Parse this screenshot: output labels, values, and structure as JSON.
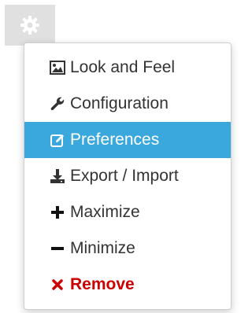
{
  "toolbar": {
    "settings_icon": "gear-icon"
  },
  "menu": {
    "items": [
      {
        "label": "Look and Feel",
        "icon": "image-icon"
      },
      {
        "label": "Configuration",
        "icon": "wrench-icon"
      },
      {
        "label": "Preferences",
        "icon": "edit-icon",
        "active": true
      },
      {
        "label": "Export / Import",
        "icon": "download-icon"
      },
      {
        "label": "Maximize",
        "icon": "plus-icon"
      },
      {
        "label": "Minimize",
        "icon": "minus-icon"
      },
      {
        "label": "Remove",
        "icon": "close-icon",
        "danger": true
      }
    ]
  },
  "colors": {
    "active_background": "#3aa8dd",
    "remove_color": "#cc0000",
    "gear_button_background": "#e0e0e0"
  }
}
